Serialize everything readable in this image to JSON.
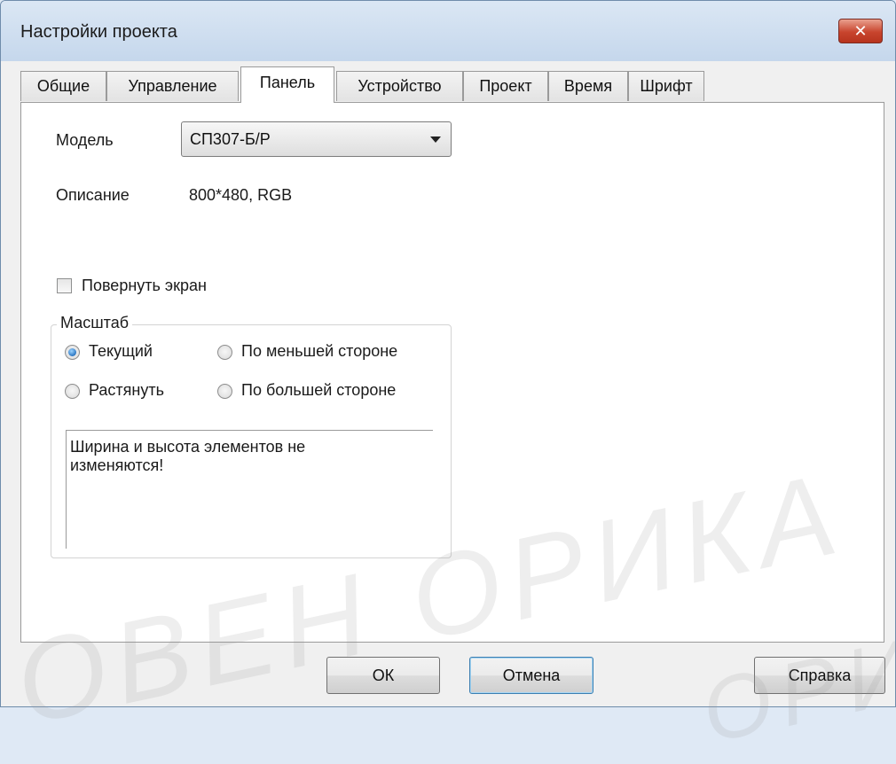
{
  "window": {
    "title": "Настройки проекта",
    "close_symbol": "✕"
  },
  "tabs": [
    {
      "label": "Общие"
    },
    {
      "label": "Управление"
    },
    {
      "label": "Панель",
      "active": true
    },
    {
      "label": "Устройство"
    },
    {
      "label": "Проект"
    },
    {
      "label": "Время"
    },
    {
      "label": "Шрифт"
    }
  ],
  "panel": {
    "model_label": "Модель",
    "model_value": "СП307-Б/Р",
    "description_label": "Описание",
    "description_value": "800*480, RGB",
    "rotate_label": "Повернуть экран",
    "rotate_checked": false,
    "scale": {
      "title": "Масштаб",
      "options": [
        {
          "label": "Текущий",
          "checked": true
        },
        {
          "label": "По меньшей стороне",
          "checked": false
        },
        {
          "label": "Растянуть",
          "checked": false
        },
        {
          "label": "По большей стороне",
          "checked": false
        }
      ],
      "note": "Ширина и высота элементов не изменяются!"
    }
  },
  "buttons": {
    "ok": "ОК",
    "cancel": "Отмена",
    "help": "Справка"
  },
  "watermark": {
    "text": "ОВЕН ОРИКА",
    "text_right": "ОРИК"
  },
  "colors": {
    "close_button": "#c8442d",
    "radio_selected": "#2b76c2"
  }
}
